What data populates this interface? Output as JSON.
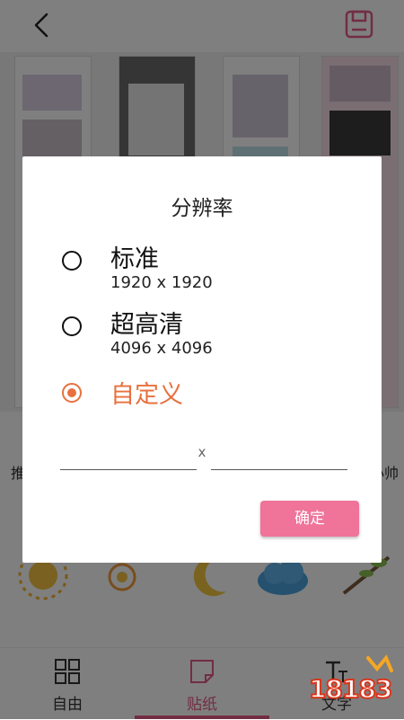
{
  "header": {
    "back_icon": "back-arrow-icon",
    "save_icon": "save-icon",
    "accent": "#e45b84"
  },
  "background": {
    "info_left": "推",
    "info_right": "小帅"
  },
  "bottom_nav": {
    "items": [
      {
        "label": "自由",
        "icon": "grid-icon"
      },
      {
        "label": "贴纸",
        "icon": "sticker-icon",
        "active": true
      },
      {
        "label": "文字",
        "icon": "text-icon"
      }
    ]
  },
  "dialog": {
    "title": "分辨率",
    "options": [
      {
        "label": "标准",
        "sub": "1920 x 1920",
        "checked": false
      },
      {
        "label": "超高清",
        "sub": "4096 x 4096",
        "checked": false
      },
      {
        "label": "自定义",
        "checked": true
      }
    ],
    "width_value": "",
    "height_value": "",
    "separator": "x",
    "confirm_label": "确定",
    "accent_color": "#e8703e",
    "button_color": "#f07399"
  },
  "watermark": {
    "text": "18183"
  }
}
